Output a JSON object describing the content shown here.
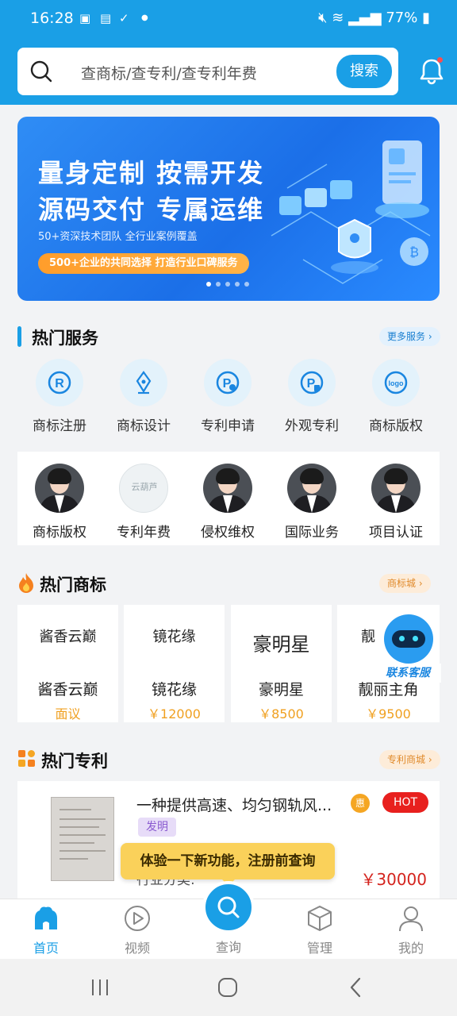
{
  "status_bar": {
    "time": "16:28",
    "battery": "77%"
  },
  "search": {
    "placeholder": "查商标/查专利/查专利年费",
    "button": "搜索"
  },
  "banner": {
    "line1": "量身定制 按需开发",
    "line2": "源码交付 专属运维",
    "sub": "50+资深技术团队 全行业案例覆盖",
    "pill": "500+企业的共同选择 打造行业口碑服务",
    "page": 1,
    "pages": 5
  },
  "hot_services": {
    "title": "热门服务",
    "more": "更多服务",
    "items": [
      {
        "label": "商标注册",
        "icon": "trademark-r-icon"
      },
      {
        "label": "商标设计",
        "icon": "pen-nib-icon"
      },
      {
        "label": "专利申请",
        "icon": "patent-p-icon"
      },
      {
        "label": "外观专利",
        "icon": "design-patent-icon"
      },
      {
        "label": "商标版权",
        "icon": "logo-icon"
      }
    ],
    "people": [
      {
        "label": "商标版权"
      },
      {
        "label": "专利年费",
        "logo_text": "云葫芦"
      },
      {
        "label": "侵权维权"
      },
      {
        "label": "国际业务"
      },
      {
        "label": "项目认证"
      }
    ]
  },
  "hot_trademarks": {
    "title": "热门商标",
    "more": "商标城",
    "items": [
      {
        "art": "酱香云巅",
        "name": "酱香云巅",
        "price": "面议"
      },
      {
        "art": "镜花缘",
        "name": "镜花缘",
        "price": "￥12000"
      },
      {
        "art": "豪明星",
        "name": "豪明星",
        "price": "￥8500"
      },
      {
        "art": "靓",
        "name": "靓丽主角",
        "price": "￥9500"
      }
    ]
  },
  "customer_service": {
    "label": "联系客服"
  },
  "hot_patents": {
    "title": "热门专利",
    "more": "专利商城",
    "item": {
      "title": "一种提供高速、均匀钢轨风...",
      "hui": "惠",
      "hot": "HOT",
      "type": "发明",
      "category": "行业分类:",
      "price": "￥30000"
    }
  },
  "tooltip": "体验一下新功能，注册前查询",
  "tabs": [
    {
      "label": "首页",
      "active": true
    },
    {
      "label": "视频"
    },
    {
      "label": "查询"
    },
    {
      "label": "管理"
    },
    {
      "label": "我的"
    }
  ],
  "colors": {
    "primary": "#1a9fe6",
    "price_red": "#d4241e",
    "price_orange": "#f0a020",
    "tooltip": "#fad15a"
  }
}
